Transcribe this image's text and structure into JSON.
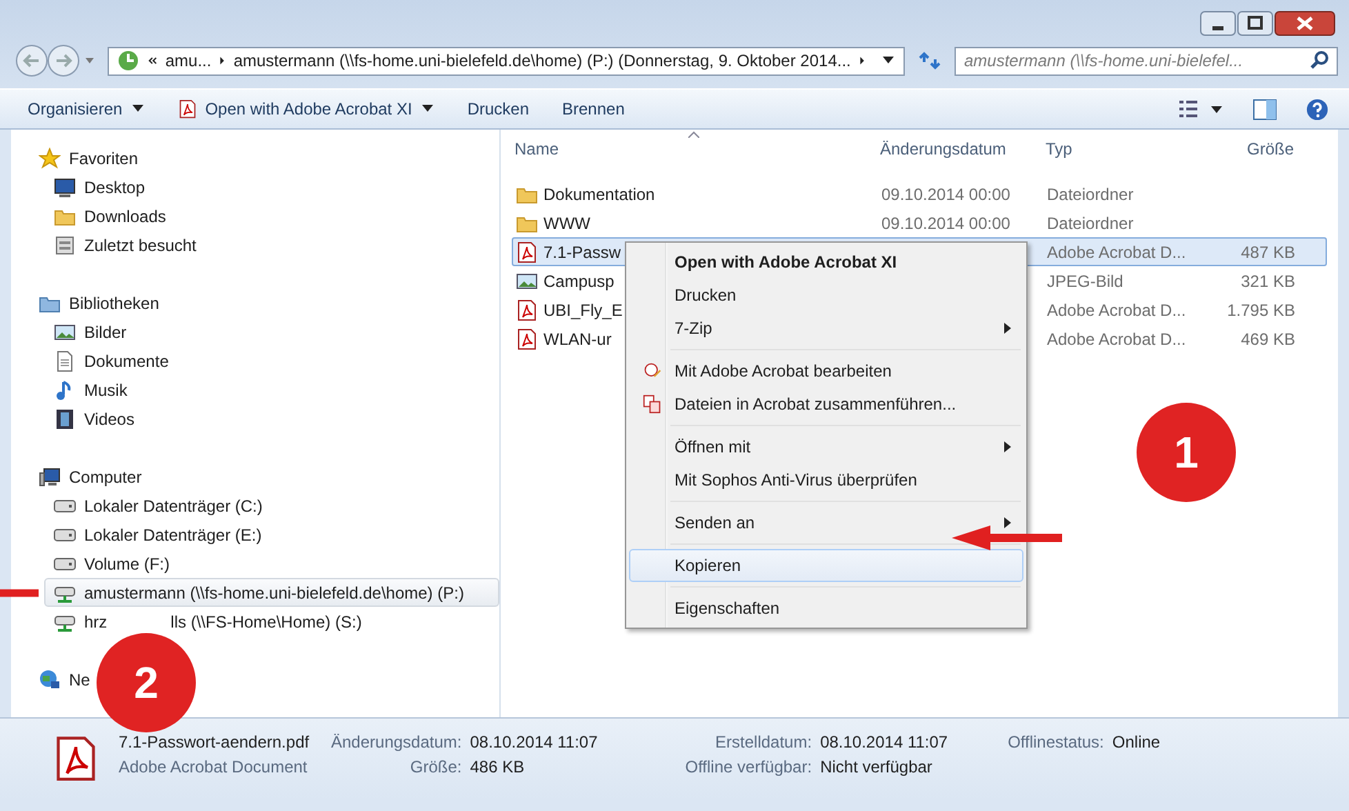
{
  "address_bar": {
    "segments": [
      "amu...",
      "amustermann (\\\\fs-home.uni-bielefeld.de\\home) (P:) (Donnerstag, 9. Oktober 2014..."
    ]
  },
  "search": {
    "placeholder": "amustermann (\\\\fs-home.uni-bielefel..."
  },
  "toolbar": {
    "items": [
      {
        "label": "Organisieren",
        "kind": "menu"
      },
      {
        "label": "Open with Adobe Acrobat XI",
        "kind": "app-menu"
      },
      {
        "label": "Drucken",
        "kind": "button"
      },
      {
        "label": "Brennen",
        "kind": "button"
      }
    ]
  },
  "sidebar": {
    "groups": [
      {
        "heading": "Favoriten",
        "items": [
          {
            "label": "Desktop",
            "selected": false
          },
          {
            "label": "Downloads",
            "selected": false
          },
          {
            "label": "Zuletzt besucht",
            "selected": false
          }
        ]
      },
      {
        "heading": "Bibliotheken",
        "items": [
          {
            "label": "Bilder",
            "selected": false
          },
          {
            "label": "Dokumente",
            "selected": false
          },
          {
            "label": "Musik",
            "selected": false
          },
          {
            "label": "Videos",
            "selected": false
          }
        ]
      },
      {
        "heading": "Computer",
        "items": [
          {
            "label": "Lokaler Datenträger (C:)",
            "selected": false
          },
          {
            "label": "Lokaler Datenträger (E:)",
            "selected": false
          },
          {
            "label": "Volume (F:)",
            "selected": false
          },
          {
            "label": "amustermann (\\\\fs-home.uni-bielefeld.de\\home) (P:)",
            "selected": true
          },
          {
            "label": "hrz",
            "label_after": "lls (\\\\FS-Home\\Home) (S:)",
            "selected": false
          }
        ]
      },
      {
        "heading": "Ne"
      }
    ]
  },
  "file_list": {
    "columns": [
      "Name",
      "Änderungsdatum",
      "Typ",
      "Größe"
    ],
    "rows": [
      {
        "name": "Dokumentation",
        "date": "09.10.2014 00:00",
        "type": "Dateiordner",
        "kind": "folder",
        "selected": false
      },
      {
        "name": "WWW",
        "date": "09.10.2014 00:00",
        "type": "Dateiordner",
        "kind": "folder",
        "selected": false
      },
      {
        "name": "7.1-Passw",
        "type": "Adobe Acrobat D...",
        "size": "487 KB",
        "kind": "pdf",
        "selected": true
      },
      {
        "name": "Campusp",
        "type": "JPEG-Bild",
        "size": "321 KB",
        "kind": "image",
        "selected": false
      },
      {
        "name": "UBI_Fly_E",
        "type": "Adobe Acrobat D...",
        "size": "1.795 KB",
        "kind": "pdf",
        "selected": false
      },
      {
        "name": "WLAN-ur",
        "type": "Adobe Acrobat D...",
        "size": "469 KB",
        "kind": "pdf",
        "selected": false
      }
    ]
  },
  "context_menu": {
    "items": [
      {
        "kind": "item",
        "label": "Open with Adobe Acrobat XI",
        "bold": true,
        "submenu": false,
        "selected": false
      },
      {
        "kind": "item",
        "label": "Drucken",
        "bold": false,
        "submenu": false,
        "selected": false
      },
      {
        "kind": "item",
        "label": "7-Zip",
        "bold": false,
        "submenu": true,
        "selected": false
      },
      {
        "kind": "separator"
      },
      {
        "kind": "item",
        "label": "Mit Adobe Acrobat bearbeiten",
        "bold": false,
        "submenu": false,
        "selected": false
      },
      {
        "kind": "item",
        "label": "Dateien in Acrobat zusammenführen...",
        "bold": false,
        "submenu": false,
        "selected": false
      },
      {
        "kind": "separator"
      },
      {
        "kind": "item",
        "label": "Öffnen mit",
        "bold": false,
        "submenu": true,
        "selected": false
      },
      {
        "kind": "item",
        "label": "Mit Sophos Anti-Virus überprüfen",
        "bold": false,
        "submenu": false,
        "selected": false
      },
      {
        "kind": "separator"
      },
      {
        "kind": "item",
        "label": "Senden an",
        "bold": false,
        "submenu": true,
        "selected": false
      },
      {
        "kind": "separator"
      },
      {
        "kind": "item",
        "label": "Kopieren",
        "bold": false,
        "submenu": false,
        "selected": true
      },
      {
        "kind": "separator"
      },
      {
        "kind": "item",
        "label": "Eigenschaften",
        "bold": false,
        "submenu": false,
        "selected": false
      }
    ]
  },
  "details": {
    "filename": "7.1-Passwort-aendern.pdf",
    "file_type": "Adobe Acrobat Document",
    "fields": [
      {
        "label": "Änderungsdatum:",
        "value": "08.10.2014 11:07"
      },
      {
        "label": "Erstelldatum:",
        "value": "08.10.2014 11:07"
      },
      {
        "label": "Offlinestatus:",
        "value": "Online"
      },
      {
        "label": "Größe:",
        "value": "486 KB"
      },
      {
        "label": "Offline verfügbar:",
        "value": "Nicht verfügbar"
      }
    ]
  },
  "annotations": [
    {
      "label": "1"
    },
    {
      "label": "2"
    }
  ]
}
